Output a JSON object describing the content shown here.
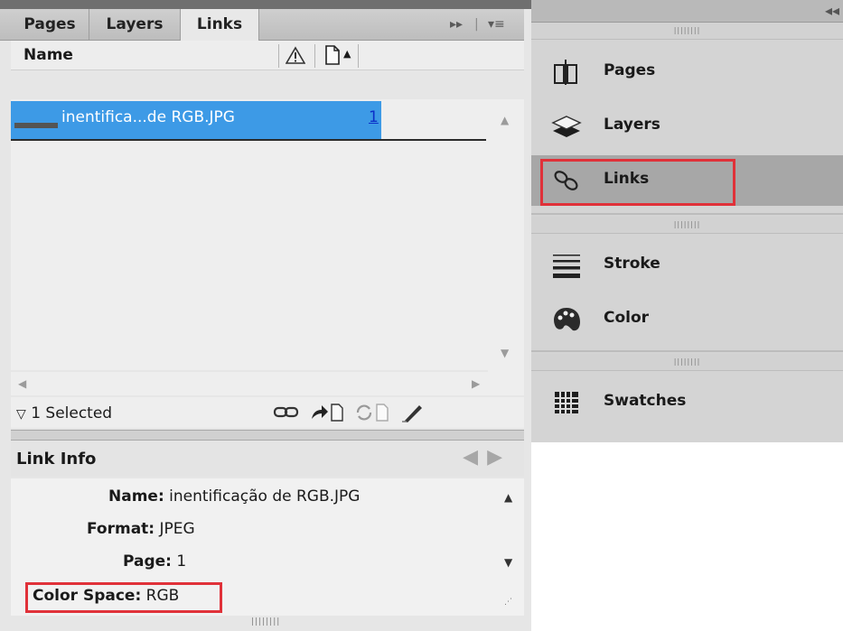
{
  "links_panel": {
    "tabs": [
      {
        "label": "Pages"
      },
      {
        "label": "Layers"
      },
      {
        "label": "Links"
      }
    ],
    "column_header": {
      "name": "Name"
    },
    "rows": [
      {
        "name": "inentifica...de RGB.JPG",
        "page": "1"
      }
    ],
    "status": {
      "text": "1 Selected"
    }
  },
  "link_info": {
    "title": "Link Info",
    "fields": [
      {
        "label": "Name:",
        "value": "inentificação de RGB.JPG"
      },
      {
        "label": "Format:",
        "value": "JPEG"
      },
      {
        "label": "Page:",
        "value": "1"
      },
      {
        "label": "Color Space:",
        "value": "RGB"
      }
    ]
  },
  "dock": {
    "items": [
      {
        "label": "Pages",
        "icon": "pages-icon"
      },
      {
        "label": "Layers",
        "icon": "layers-icon"
      },
      {
        "label": "Links",
        "icon": "links-icon",
        "selected": true
      },
      {
        "label": "Stroke",
        "icon": "stroke-icon"
      },
      {
        "label": "Color",
        "icon": "color-palette-icon"
      },
      {
        "label": "Swatches",
        "icon": "swatches-icon"
      }
    ]
  },
  "colors": {
    "selection": "#3d9ae6",
    "highlight_border": "#e03139",
    "page_link": "#0b30c8"
  }
}
